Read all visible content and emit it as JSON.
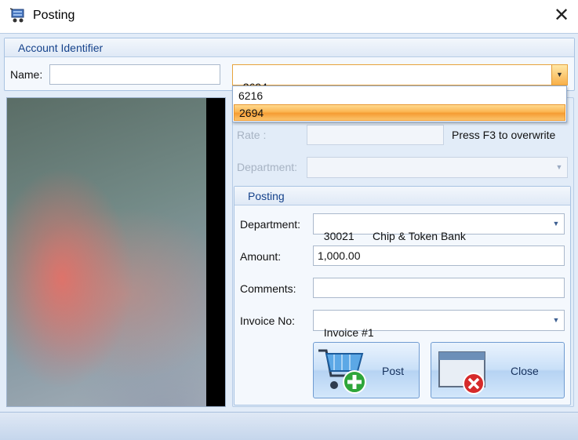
{
  "window": {
    "title": "Posting",
    "close_glyph": "✕"
  },
  "account_identifier": {
    "header": "Account Identifier",
    "name_label": "Name:",
    "name_value": "",
    "account_combo_value": "2694",
    "dropdown_options": [
      "6216",
      "2694"
    ],
    "selected_option": "2694"
  },
  "rate": {
    "label": "Rate :",
    "value": "",
    "hint": "Press F3 to overwrite"
  },
  "department_top": {
    "label": "Department:",
    "value": ""
  },
  "posting": {
    "header": "Posting",
    "department_label": "Department:",
    "department_value": "30021      Chip & Token Bank",
    "amount_label": "Amount:",
    "amount_value": "1,000.00",
    "comments_label": "Comments:",
    "comments_value": "",
    "invoice_label": "Invoice No:",
    "invoice_value": "Invoice #1",
    "post_button": "Post",
    "close_button": "Close"
  },
  "icons": {
    "app": "cart-icon",
    "post": "cart-add-icon",
    "close": "window-close-icon",
    "dropdown": "chevron-down-icon"
  },
  "colors": {
    "accent": "#15428b",
    "frame": "#e2ecf8",
    "highlight": "#f8b04a"
  }
}
